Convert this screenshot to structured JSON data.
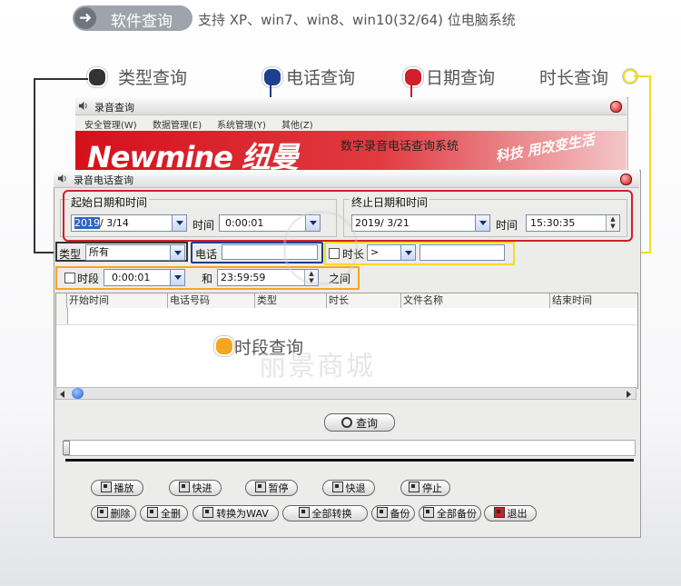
{
  "banner": {
    "title": "软件查询",
    "support_text": "支持 XP、win7、win8、win10(32/64) 位电脑系统"
  },
  "callouts": {
    "type": "类型查询",
    "phone": "电话查询",
    "date": "日期查询",
    "duration": "时长查询",
    "period": "时段查询"
  },
  "colors": {
    "type": "#333333",
    "phone": "#1d3f8f",
    "date": "#d0202a",
    "duration": "#f2dc25",
    "period": "#f5a623"
  },
  "window1": {
    "title": "录音查询",
    "menu": [
      "安全管理(W)",
      "数据管理(E)",
      "系统管理(Y)",
      "其他(Z)"
    ],
    "logo": "Newmine 纽曼",
    "subtitle": "数字录音电话查询系统",
    "slogan": "科技 用改变生活"
  },
  "window2": {
    "title": "录音电话查询",
    "start_group": "起始日期和时间",
    "end_group": "终止日期和时间",
    "start_date_sel": "2019",
    "start_date_rest": "/ 3/14",
    "time_label": "时间",
    "start_time": "0:00:01",
    "end_date": "2019/ 3/21",
    "end_time": "15:30:35",
    "type_label": "类型",
    "type_value": "所有",
    "phone_label": "电话",
    "phone_value": "",
    "duration_label": "时长",
    "duration_op": ">",
    "duration_value": "",
    "period_label": "时段",
    "period_start": "0:00:01",
    "and_label": "和",
    "period_end": "23:59:59",
    "between_label": "之间",
    "columns": [
      "开始时间",
      "电话号码",
      "类型",
      "时长",
      "文件名称",
      "结束时间"
    ],
    "query_button": "查询",
    "controls_row1": [
      "播放",
      "快进",
      "暂停",
      "快退",
      "停止"
    ],
    "controls_row2": [
      "删除",
      "全删",
      "转换为WAV",
      "全部转换",
      "备份",
      "全部备份",
      "退出"
    ]
  },
  "watermark": "丽景商城"
}
